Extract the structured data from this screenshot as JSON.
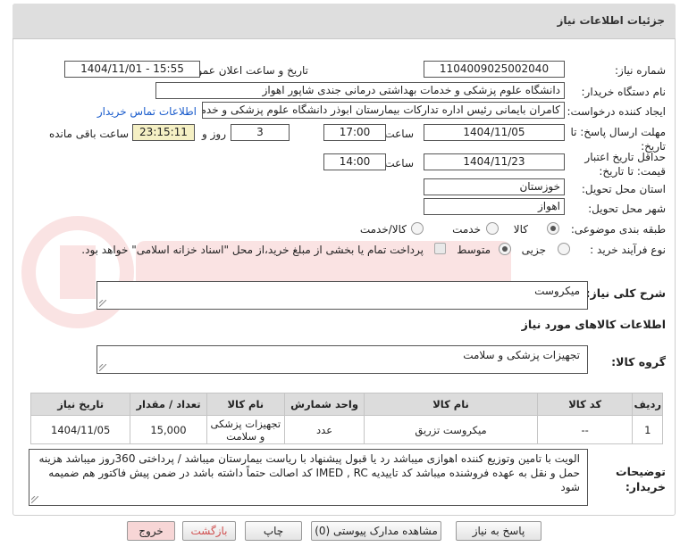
{
  "header": {
    "title": "جزئیات اطلاعات نیاز"
  },
  "fields": {
    "need_number": {
      "label": "شماره نیاز:",
      "value": "1104009025002040"
    },
    "announce_datetime": {
      "label": "تاریخ و ساعت اعلان عمومی:",
      "value": "1404/11/01 - 15:55"
    },
    "buyer_org": {
      "label": "نام دستگاه خریدار:",
      "value": "دانشگاه علوم پزشکی و خدمات بهداشتی درمانی جندی شاپور اهواز"
    },
    "requester": {
      "label": "ایجاد کننده درخواست:",
      "value": "کامران بایمانی رئیس اداره تدارکات بیمارستان ابوذر  دانشگاه علوم پزشکی و خدمات بهداشتی درمانی جندی شاپور اهواز",
      "contact_link": "اطلاعات تماس خریدار"
    },
    "reply_deadline": {
      "label": "مهلت ارسال پاسخ: تا تاریخ:",
      "date": "1404/11/05",
      "time_label": "ساعت",
      "time": "17:00",
      "days": "3",
      "days_label": "روز و",
      "remaining": "23:15:11",
      "remaining_label": "ساعت باقی مانده"
    },
    "price_validity": {
      "label": "حداقل تاریخ اعتبار قیمت: تا تاریخ:",
      "date": "1404/11/23",
      "time_label": "ساعت",
      "time": "14:00"
    },
    "province": {
      "label": "استان محل تحویل:",
      "value": "خوزستان"
    },
    "city": {
      "label": "شهر محل تحویل:",
      "value": "اهواز"
    },
    "category": {
      "label": "طبقه بندی موضوعی:",
      "options": [
        "کالا",
        "خدمت",
        "کالا/خدمت"
      ],
      "selected": "کالا"
    },
    "process_type": {
      "label": "نوع فرآیند خرید :",
      "options": [
        "جزیی",
        "متوسط"
      ],
      "selected": "متوسط",
      "treasury_text": "پرداخت تمام یا بخشی از مبلغ خرید،از محل \"اسناد خزانه اسلامی\" خواهد بود."
    }
  },
  "summary": {
    "label": "شرح کلی نیاز:",
    "value": "میکروست"
  },
  "goods_section": {
    "title": "اطلاعات کالاهای مورد نیاز"
  },
  "goods_group": {
    "label": "گروه کالا:",
    "value": "تجهیزات پزشکی و سلامت"
  },
  "table": {
    "columns": [
      "ردیف",
      "کد کالا",
      "نام کالا",
      "واحد شمارش",
      "نام کالا",
      "تعداد / مقدار",
      "تاریخ نیاز"
    ],
    "headers": {
      "row": "ردیف",
      "code": "کد کالا",
      "name": "نام کالا",
      "unit": "واحد شمارش",
      "goods": "نام کالا",
      "qty": "تعداد / مقدار",
      "date": "تاریخ نیاز"
    },
    "rows": [
      {
        "row": "1",
        "code": "--",
        "name": "میکروست تزریق",
        "unit": "عدد",
        "goods": "تجهیزات پزشکی و سلامت",
        "qty": "15,000",
        "date": "1404/11/05"
      }
    ]
  },
  "buyer_notes": {
    "label": "توضیحات خریدار:",
    "value": "الویت با تامین وتوزیع کننده اهوازی میباشد رد یا قبول پیشنهاد با ریاست بیمارستان میباشد / پرداختی  360روز  میباشد هزینه حمل و نقل به عهده فروشنده میباشد کد تاییدیه IMED , RC کد اصالت حتماً داشته باشد در ضمن پیش فاکتور هم ضمیمه شود"
  },
  "buttons": {
    "reply": "پاسخ به نیاز",
    "docs": "مشاهده مدارک پیوستی (0)",
    "print": "چاپ",
    "back": "بازگشت",
    "exit": "خروج"
  },
  "colors": {
    "link": "#1a5ccc",
    "back_text": "#d05050",
    "exit_bg": "#f7d6d6",
    "remaining_bg": "#f5f0c4"
  }
}
